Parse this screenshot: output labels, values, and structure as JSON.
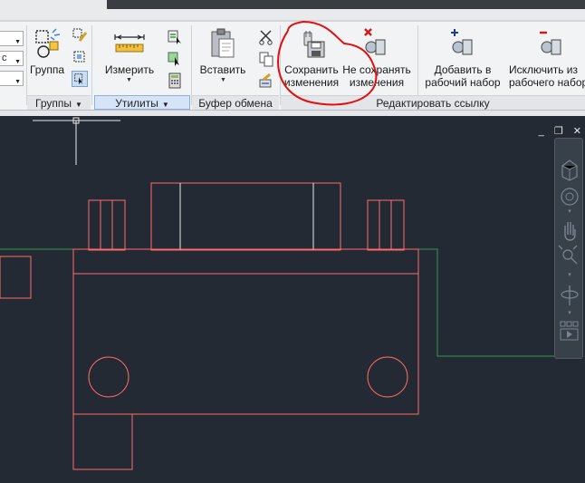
{
  "ribbon": {
    "combos": [
      {
        "value": "",
        "arrow": "▼"
      },
      {
        "value": "с",
        "arrow": "▼"
      },
      {
        "value": "",
        "arrow": "▼"
      }
    ],
    "groups_panel": {
      "button_label": "Группа",
      "title": "Группы"
    },
    "utilities_panel": {
      "button_label": "Измерить",
      "title": "Утилиты"
    },
    "clipboard_panel": {
      "button_label": "Вставить",
      "title": "Буфер обмена"
    },
    "edit_ref_panel": {
      "title": "Редактировать ссылку",
      "save_line1": "Сохранить",
      "save_line2": "изменения",
      "discard_line1": "Не сохранять",
      "discard_line2": "изменения",
      "add_line1": "Добавить в",
      "add_line2": "рабочий набор",
      "remove_line1": "Исключить из",
      "remove_line2": "рабочего набор"
    }
  },
  "viewport": {
    "minimize": "_",
    "restore": "❐",
    "close": "✕"
  },
  "colors": {
    "ribbon_bg": "#f2f3f4",
    "canvas_bg": "#232a33",
    "drawing_lines": "#ff6b6b",
    "green_line": "#2e9a4a",
    "annotation": "#e01010"
  }
}
